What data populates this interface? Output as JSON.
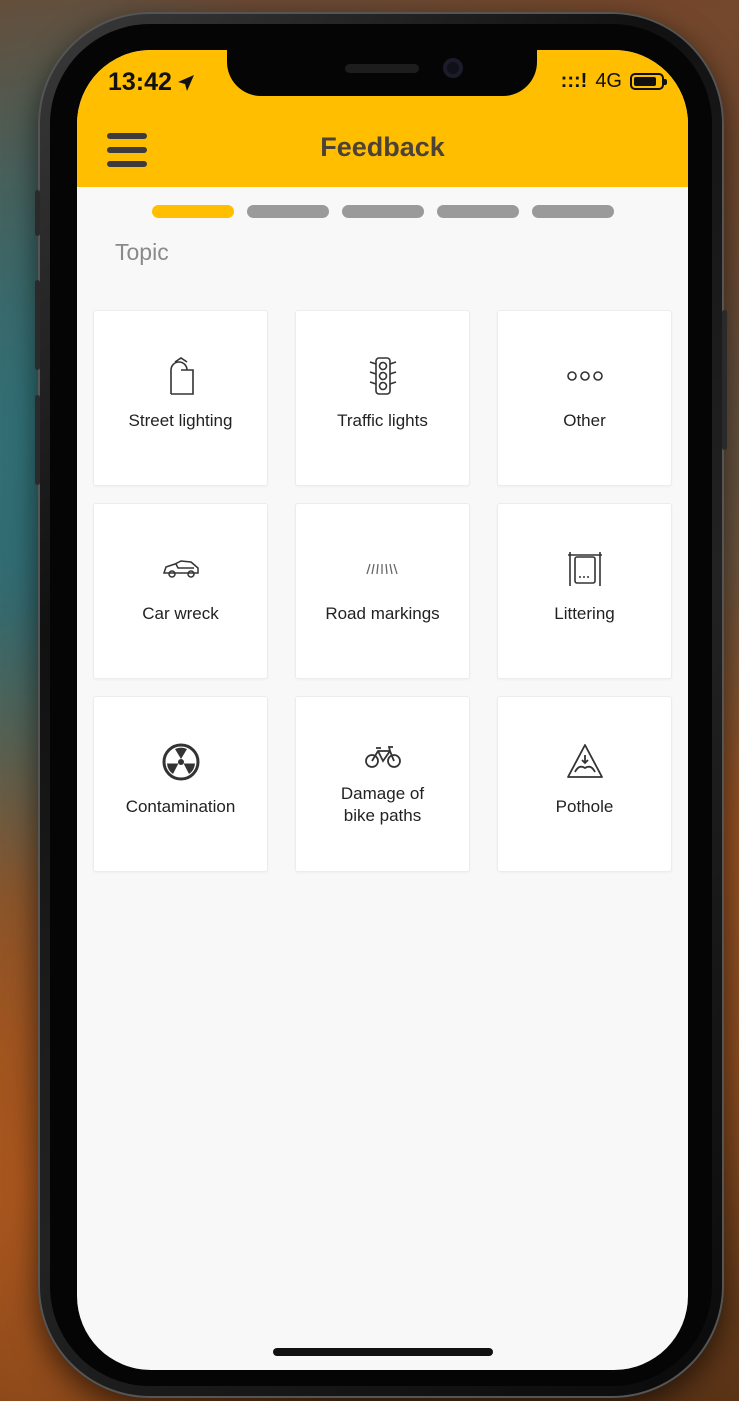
{
  "status_bar": {
    "time": "13:42",
    "signal": ":::!",
    "network": "4G"
  },
  "header": {
    "title": "Feedback"
  },
  "progress": {
    "total_steps": 5,
    "current_step": 1
  },
  "topic_label": "Topic",
  "topics": [
    {
      "label": "Street lighting",
      "icon": "street-lamp-icon"
    },
    {
      "label": "Traffic lights",
      "icon": "traffic-light-icon"
    },
    {
      "label": "Other",
      "icon": "more-dots-icon"
    },
    {
      "label": "Car wreck",
      "icon": "car-icon"
    },
    {
      "label": "Road markings",
      "icon": "road-markings-icon"
    },
    {
      "label": "Littering",
      "icon": "trash-bin-icon"
    },
    {
      "label": "Contamination",
      "icon": "radiation-icon"
    },
    {
      "label": "Damage of\nbike paths",
      "icon": "bicycle-icon"
    },
    {
      "label": "Pothole",
      "icon": "pothole-icon"
    }
  ],
  "colors": {
    "accent": "#ffbe00",
    "title_text": "#4d4236",
    "inactive_step": "#9a9a9a"
  }
}
